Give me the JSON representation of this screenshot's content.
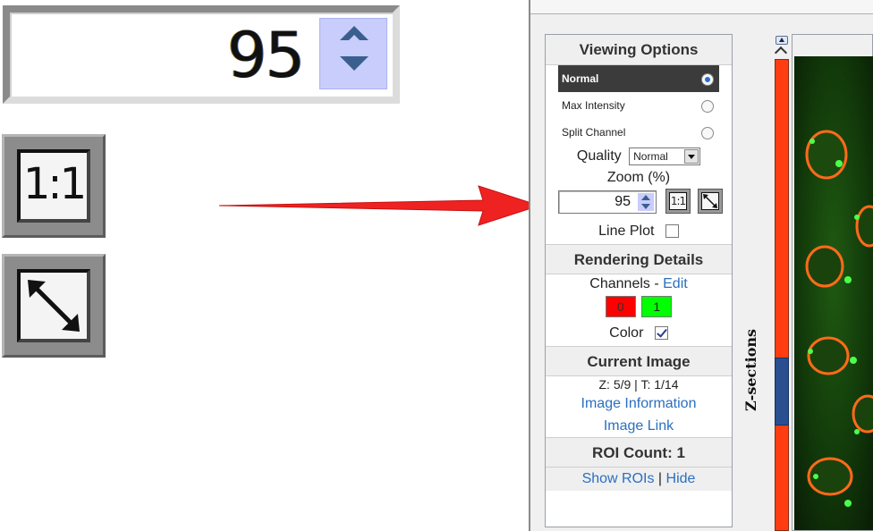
{
  "zoomed": {
    "spinner_value": "95",
    "one_to_one_label": "1:1",
    "fit_icon": "diagonal-resize-arrow"
  },
  "viewing_options": {
    "title": "Viewing Options",
    "modes": [
      {
        "label": "Normal",
        "selected": true
      },
      {
        "label": "Max Intensity",
        "selected": false
      },
      {
        "label": "Split Channel",
        "selected": false
      }
    ],
    "quality_label": "Quality",
    "quality_value": "Normal",
    "zoom_label": "Zoom (%)",
    "zoom_value": "95",
    "one_to_one_label": "1:1",
    "line_plot_label": "Line Plot",
    "line_plot_checked": false
  },
  "rendering_details": {
    "title": "Rendering Details",
    "channels_label": "Channels - ",
    "edit_link": "Edit",
    "channels": [
      {
        "label": "0",
        "color": "#ff0000"
      },
      {
        "label": "1",
        "color": "#00ff00"
      }
    ],
    "color_label": "Color",
    "color_checked": true
  },
  "current_image": {
    "title": "Current Image",
    "position": "Z: 5/9 | T: 1/14",
    "info_link": "Image Information",
    "image_link": "Image Link"
  },
  "roi": {
    "count_label": "ROI Count: 1",
    "show_link": "Show ROIs",
    "separator": " | ",
    "hide_link": "Hide"
  },
  "z_sections": {
    "label": "Z-sections"
  },
  "colors": {
    "arrow": "#ef2222",
    "slider_track": "#ff3d10",
    "slider_thumb": "#2a4f90",
    "link": "#2a6fc0"
  }
}
